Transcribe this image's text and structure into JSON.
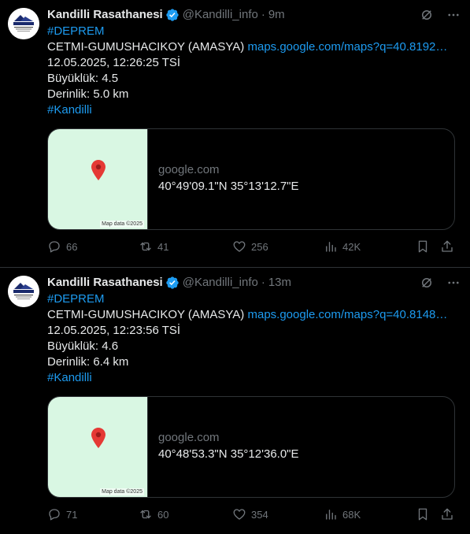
{
  "colors": {
    "accent": "#1d9bf0",
    "muted": "#71767b",
    "text": "#e7e9ea",
    "background": "#000000",
    "map_bg": "#d9f7e3",
    "pin": "#e53935"
  },
  "tweets": [
    {
      "avatar_icon": "kandilli-logo-icon",
      "author": "Kandilli Rasathanesi",
      "handle": "@Kandilli_info",
      "separator": "·",
      "time": "9m",
      "hashtag_top": "#DEPREM",
      "location": "CETMI-GUMUSHACIKOY (AMASYA)",
      "maps_link": "maps.google.com/maps?q=40.8192…",
      "datetime": "12.05.2025, 12:26:25 TSİ",
      "magnitude": "Büyüklük: 4.5",
      "depth": "Derinlik: 5.0 km",
      "hashtag_bottom": "#Kandilli",
      "card": {
        "map_credit": "Map data ©2025",
        "domain": "google.com",
        "coords": "40°49'09.1\"N 35°13'12.7\"E"
      },
      "stats": {
        "replies": "66",
        "reposts": "41",
        "likes": "256",
        "views": "42K"
      }
    },
    {
      "avatar_icon": "kandilli-logo-icon",
      "author": "Kandilli Rasathanesi",
      "handle": "@Kandilli_info",
      "separator": "·",
      "time": "13m",
      "hashtag_top": "#DEPREM",
      "location": "CETMI-GUMUSHACIKOY (AMASYA)",
      "maps_link": "maps.google.com/maps?q=40.8148…",
      "datetime": "12.05.2025, 12:23:56 TSİ",
      "magnitude": "Büyüklük: 4.6",
      "depth": "Derinlik: 6.4 km",
      "hashtag_bottom": "#Kandilli",
      "card": {
        "map_credit": "Map data ©2025",
        "domain": "google.com",
        "coords": "40°48'53.3\"N 35°12'36.0\"E"
      },
      "stats": {
        "replies": "71",
        "reposts": "60",
        "likes": "354",
        "views": "68K"
      }
    }
  ]
}
